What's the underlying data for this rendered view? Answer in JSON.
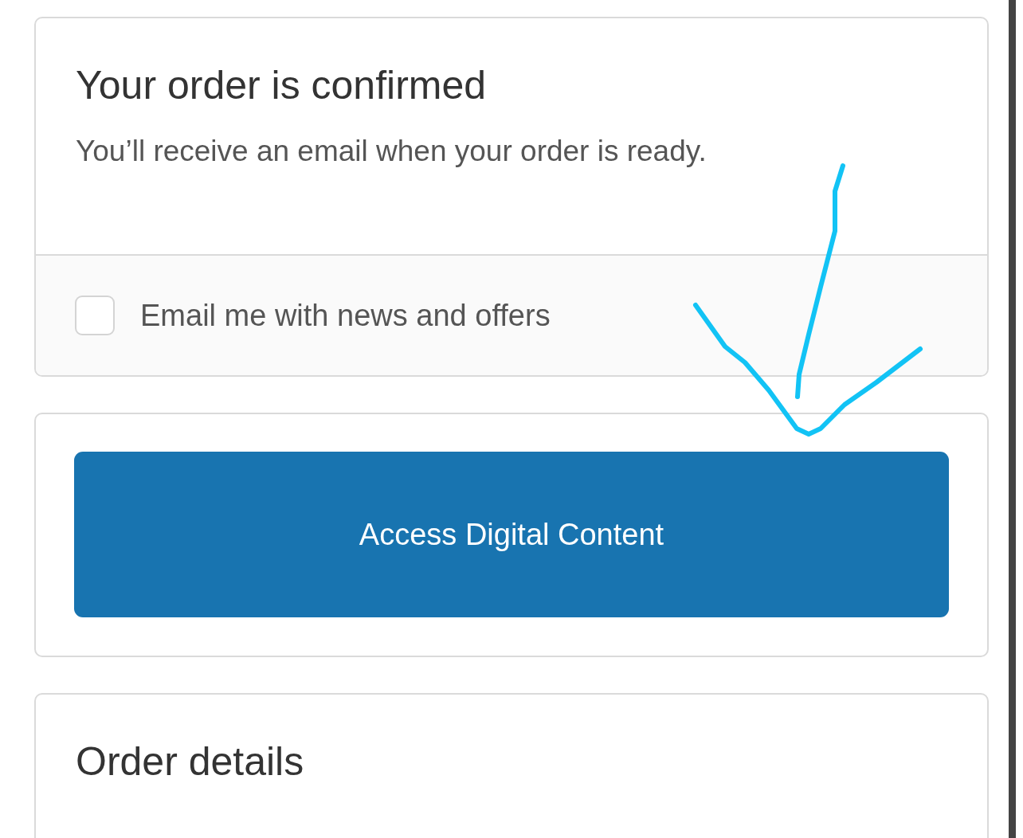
{
  "confirmation": {
    "title": "Your order is confirmed",
    "message": "You’ll receive an email when your order is ready.",
    "newsletter": {
      "label": "Email me with news and offers",
      "checked": false
    }
  },
  "action": {
    "button": "Access Digital Content"
  },
  "order_details": {
    "title": "Order details"
  }
}
